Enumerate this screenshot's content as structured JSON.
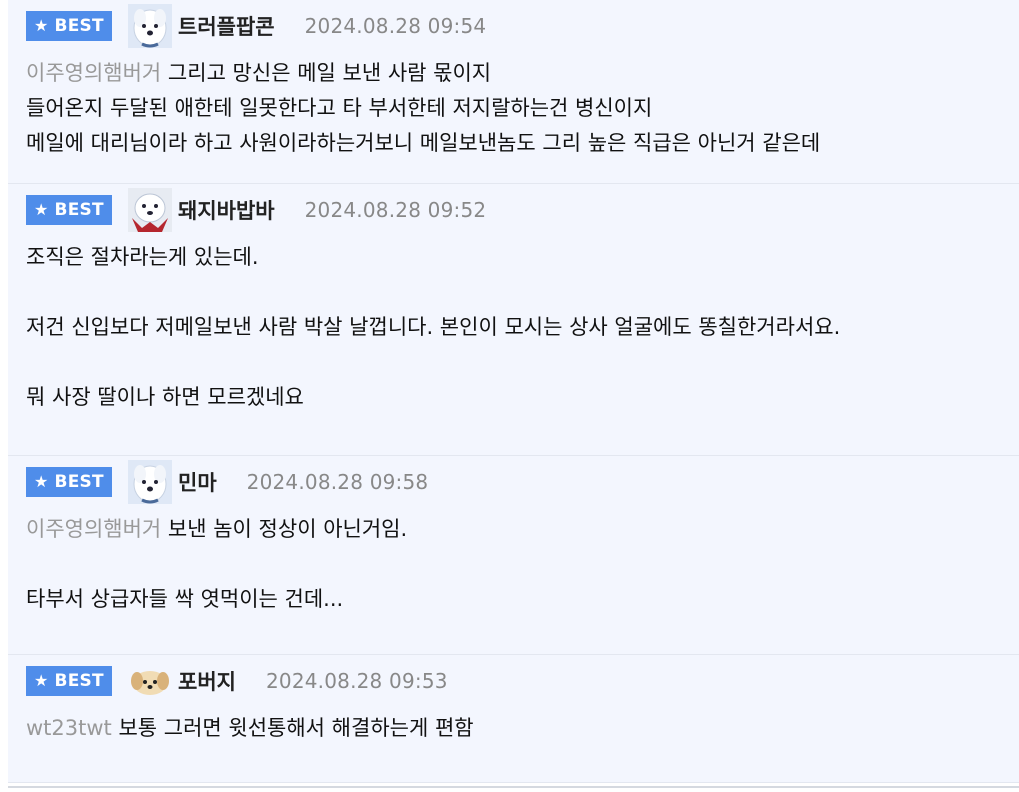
{
  "badge_label": "BEST",
  "accent_color": "#4f8dea",
  "comments": [
    {
      "nickname": "트러플팝콘",
      "datetime": "2024.08.28 09:54",
      "avatar_icon": "white-dog-avatar-icon",
      "mention": "이주영의햄버거",
      "first_line": " 그리고 망신은 메일 보낸 사람 몫이지",
      "rest": "들어온지 두달된 애한테 일못한다고 타 부서한테 저지랄하는건 병신이지\n메일에 대리님이라 하고 사원이라하는거보니 메일보낸놈도 그리 높은 직급은 아닌거 같은데"
    },
    {
      "nickname": "돼지바밥바",
      "datetime": "2024.08.28 09:52",
      "avatar_icon": "white-dog-red-avatar-icon",
      "mention": "",
      "first_line": "",
      "rest": "조직은 절차라는게 있는데.\n\n저건 신입보다 저메일보낸 사람 박살 날껍니다. 본인이 모시는 상사 얼굴에도 똥칠한거라서요.\n\n뭐 사장 딸이나 하면 모르겠네요"
    },
    {
      "nickname": "민마",
      "datetime": "2024.08.28 09:58",
      "avatar_icon": "white-dog-avatar-icon",
      "mention": "이주영의햄버거",
      "first_line": " 보낸 놈이 정상이 아닌거임.",
      "rest": "\n타부서 상급자들 싹 엿먹이는 건데..."
    },
    {
      "nickname": "포버지",
      "datetime": "2024.08.28 09:53",
      "avatar_icon": "puppy-face-avatar-icon",
      "mention": "wt23twt",
      "first_line": " 보통 그러면 윗선통해서 해결하는게 편함",
      "rest": ""
    }
  ]
}
